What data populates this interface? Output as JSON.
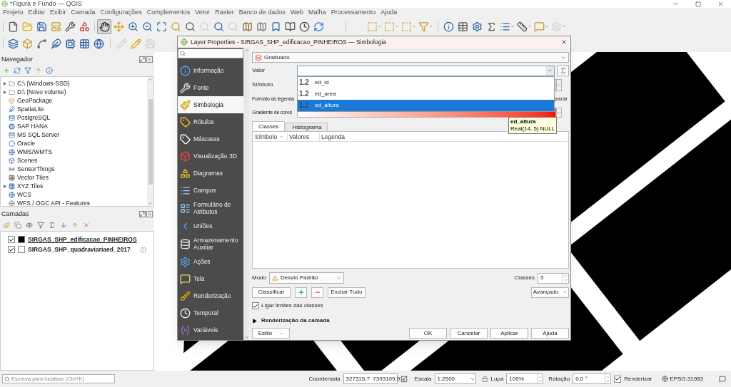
{
  "window": {
    "title": "*Figura e Fundo — QGIS"
  },
  "menu": [
    "Projeto",
    "Editar",
    "Exibir",
    "Camada",
    "Configurações",
    "Complementos",
    "Vetor",
    "Raster",
    "Banco de dados",
    "Web",
    "Malha",
    "Processamento",
    "Ajuda"
  ],
  "toolbars": [
    {
      "buttons": [
        {
          "selected": false,
          "disabled": false
        },
        {
          "selected": false,
          "disabled": false
        },
        {
          "selected": false,
          "disabled": false
        },
        {
          "selected": false,
          "disabled": false
        },
        {
          "selected": false,
          "disabled": false
        },
        {
          "selected": false,
          "disabled": false
        },
        {
          "selected": true,
          "disabled": false
        },
        {
          "selected": false,
          "disabled": false
        },
        {
          "selected": false,
          "disabled": false
        },
        {
          "selected": false,
          "disabled": false
        },
        {
          "selected": false,
          "disabled": false
        },
        {
          "selected": false,
          "disabled": false
        },
        {
          "selected": false,
          "disabled": false
        },
        {
          "selected": false,
          "disabled": true
        },
        {
          "selected": false,
          "disabled": false
        },
        {
          "selected": false,
          "disabled": true
        },
        {
          "selected": false,
          "disabled": false
        },
        {
          "selected": false,
          "disabled": false
        },
        {
          "selected": false,
          "disabled": false
        },
        {
          "selected": false,
          "disabled": false
        },
        {
          "selected": false,
          "disabled": false
        },
        {
          "selected": false,
          "disabled": false
        },
        {
          "selected": false,
          "disabled": false
        },
        {
          "selected": false,
          "disabled": false
        },
        {
          "selected": false,
          "disabled": false
        },
        {
          "selected": false,
          "disabled": false
        },
        {
          "selected": false,
          "disabled": false
        },
        {
          "selected": false,
          "disabled": false
        },
        {
          "selected": false,
          "disabled": false
        },
        {
          "selected": false,
          "disabled": false
        },
        {
          "selected": false,
          "disabled": false
        },
        {
          "selected": false,
          "disabled": false
        },
        {
          "selected": false,
          "disabled": false
        },
        {
          "selected": false,
          "disabled": true
        }
      ]
    },
    {
      "buttons": [
        {
          "selected": false,
          "disabled": false
        },
        {
          "selected": false,
          "disabled": false
        },
        {
          "selected": false,
          "disabled": false
        },
        {
          "selected": false,
          "disabled": false
        },
        {
          "selected": false,
          "disabled": false
        },
        {
          "selected": false,
          "disabled": false
        },
        {
          "selected": false,
          "disabled": false
        },
        {
          "selected": false,
          "disabled": true
        },
        {
          "selected": false,
          "disabled": false
        },
        {
          "selected": false,
          "disabled": true
        }
      ]
    }
  ],
  "browser": {
    "title": "Navegador",
    "items": [
      {
        "label": "C:\\ (Windows-SSD)",
        "expandable": true
      },
      {
        "label": "D:\\ (Novo volume)",
        "expandable": true
      },
      {
        "label": "GeoPackage",
        "expandable": false
      },
      {
        "label": "SpatiaLite",
        "expandable": false
      },
      {
        "label": "PostgreSQL",
        "expandable": false
      },
      {
        "label": "SAP HANA",
        "expandable": false
      },
      {
        "label": "MS SQL Server",
        "expandable": false
      },
      {
        "label": "Oracle",
        "expandable": false
      },
      {
        "label": "WMS/WMTS",
        "expandable": false
      },
      {
        "label": "Scenes",
        "expandable": false
      },
      {
        "label": "SensorThings",
        "expandable": false
      },
      {
        "label": "Vector Tiles",
        "expandable": false
      },
      {
        "label": "XYZ Tiles",
        "expandable": true
      },
      {
        "label": "WCS",
        "expandable": false
      },
      {
        "label": "WFS / OGC API - Features",
        "expandable": false
      }
    ]
  },
  "layers_panel": {
    "title": "Camadas",
    "layers": [
      {
        "name": "SIRGAS_SHP_edificacao_PINHEIROS",
        "checked": true,
        "selected": true,
        "warning": false,
        "color": "#000000"
      },
      {
        "name": "SIRGAS_SHP_quadraviariaed_2017",
        "checked": true,
        "selected": false,
        "warning": true,
        "color": "#ffffff"
      }
    ]
  },
  "dialog": {
    "title": "Layer Properties - SIRGAS_SHP_edificacao_PINHEIROS — Simbologia",
    "sections": [
      {
        "label": "Informação",
        "selected": false
      },
      {
        "label": "Fonte",
        "selected": false
      },
      {
        "label": "Simbologia",
        "selected": true
      },
      {
        "label": "Rótulos",
        "selected": false
      },
      {
        "label": "Máscaras",
        "selected": false
      },
      {
        "label": "Visualização 3D",
        "selected": false
      },
      {
        "label": "Diagramas",
        "selected": false
      },
      {
        "label": "Campos",
        "selected": false
      },
      {
        "label": "Formulário de Atributos",
        "selected": false
      },
      {
        "label": "Uniões",
        "selected": false
      },
      {
        "label": "Armazenamento Auxiliar",
        "selected": false
      },
      {
        "label": "Ações",
        "selected": false
      },
      {
        "label": "Tela",
        "selected": false
      },
      {
        "label": "Renderização",
        "selected": false
      },
      {
        "label": "Temporal",
        "selected": false
      },
      {
        "label": "Variáveis",
        "selected": false
      }
    ],
    "renderer": "Graduado",
    "valor_label": "Valor",
    "simbolo_label": "Símbolo",
    "formato_label": "Formato da legenda",
    "formato_tail": "parar",
    "gradiente_label": "Gradiente de cores",
    "field_options": [
      {
        "type_label": "1.2",
        "name": "ed_id",
        "selected": false
      },
      {
        "type_label": "1.2",
        "name": "ed_area",
        "selected": false
      },
      {
        "type_label": "1.2",
        "name": "ed_altura",
        "selected": true
      }
    ],
    "tooltip": {
      "title": "ed_altura",
      "detail": "Real(14, 5) NULL"
    },
    "tabs": [
      {
        "label": "Classes",
        "selected": true
      },
      {
        "label": "Histograma",
        "selected": false
      }
    ],
    "table": {
      "columns": [
        "Símbolo",
        "Valores",
        "Legenda"
      ]
    },
    "mode": {
      "label": "Modo",
      "value": "Desvio Padrão"
    },
    "classes": {
      "label": "Classes",
      "value": "5"
    },
    "buttons": {
      "classify": "Classificar",
      "delete_all": "Excluir Tudo",
      "advanced": "Avançado"
    },
    "link_bounds": {
      "label": "Ligar limites das classes",
      "checked": true
    },
    "layer_rendering": {
      "label": "Renderização da camada",
      "expanded": false
    },
    "footer": {
      "style": "Estilo",
      "ok": "OK",
      "cancel": "Cancelar",
      "apply": "Aplicar",
      "help": "Ajuda"
    }
  },
  "status_bar": {
    "search_placeholder": "Escreva para localizar (Ctrl+K)",
    "coordinate_label": "Coordenada",
    "coordinate": "327315,7  7393109,9",
    "scale_label": "Escala",
    "scale": "1:2500",
    "magnifier_label": "Lupa",
    "magnifier": "100%",
    "rotation_label": "Rotação",
    "rotation": "0,0 °",
    "render": {
      "label": "Renderizar",
      "checked": true
    },
    "crs": "EPSG:31983"
  }
}
